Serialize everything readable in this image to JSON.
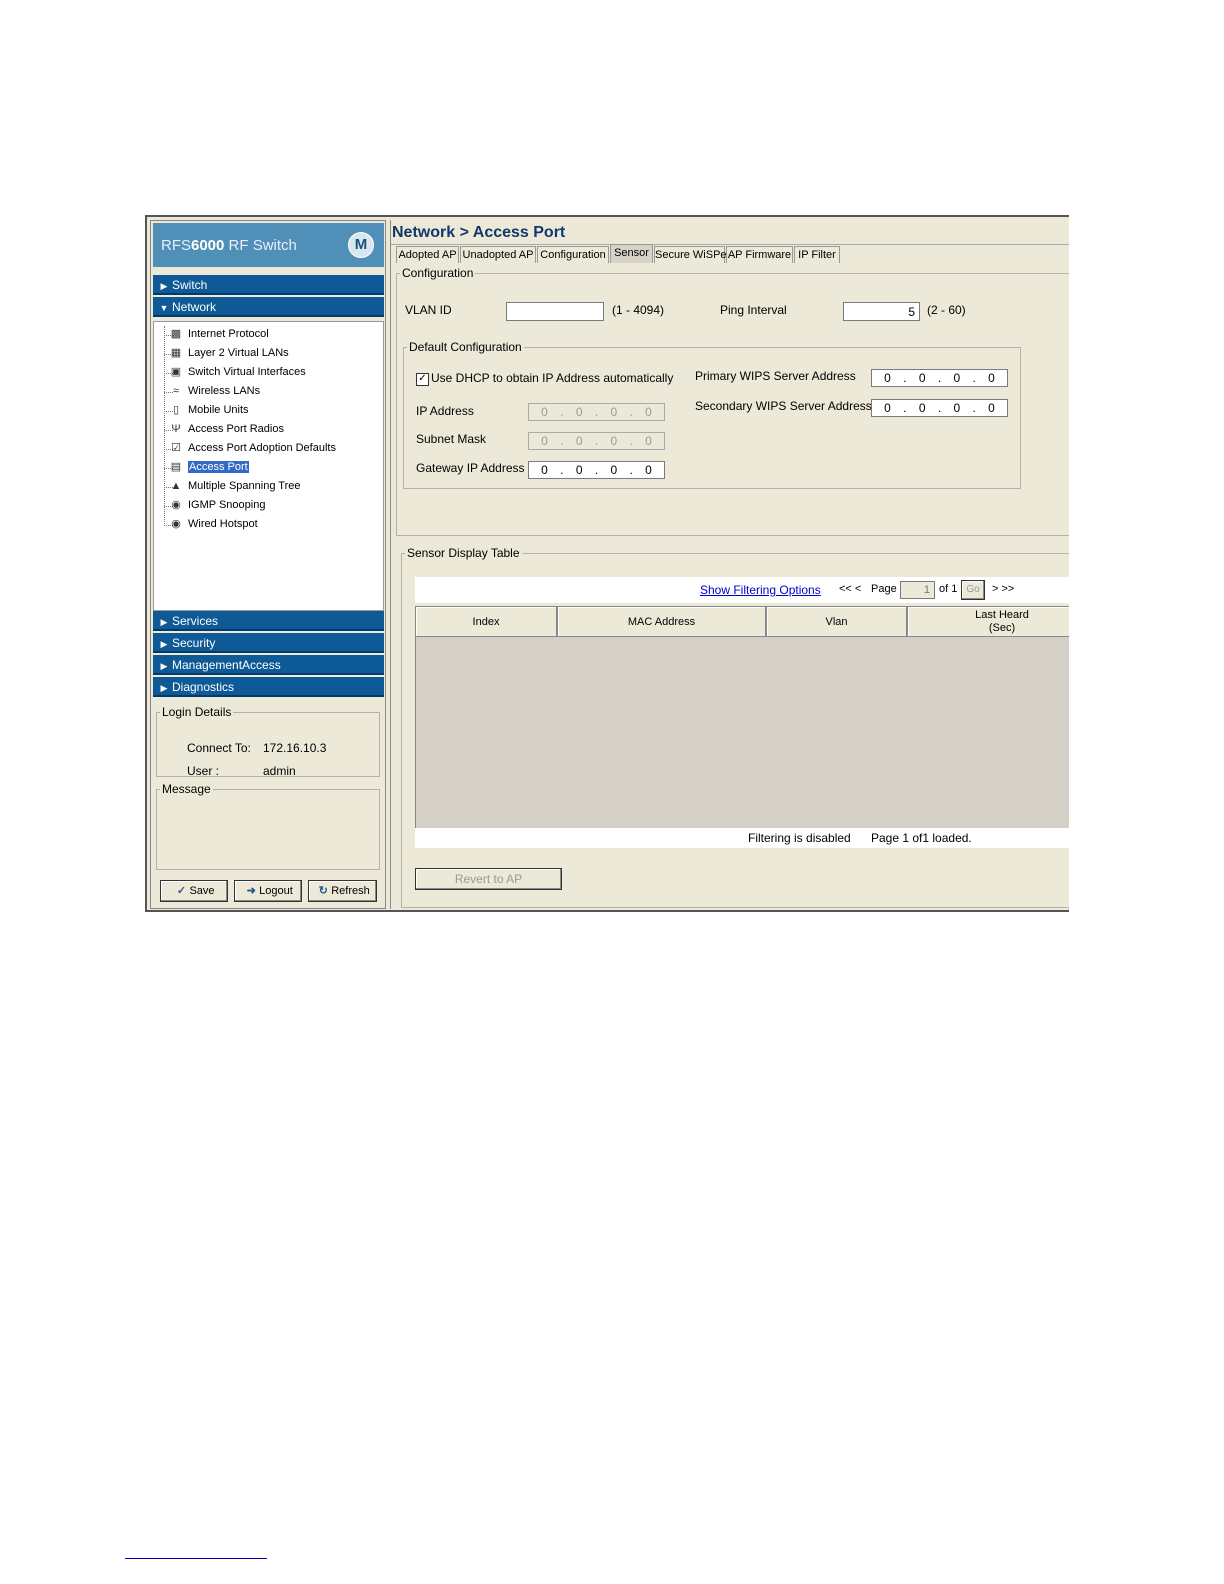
{
  "brand": {
    "title_prefix": "RFS",
    "title_bold": "6000",
    "title_suffix": " RF Switch",
    "logo": "motorola-logo"
  },
  "nav": {
    "switch": "Switch",
    "network": "Network",
    "services": "Services",
    "security": "Security",
    "management_access": "ManagementAccess",
    "diagnostics": "Diagnostics"
  },
  "tree": [
    {
      "label": "Internet Protocol",
      "icon": "ip-icon"
    },
    {
      "label": "Layer 2 Virtual LANs",
      "icon": "vlan-icon"
    },
    {
      "label": "Switch Virtual Interfaces",
      "icon": "svi-icon"
    },
    {
      "label": "Wireless LANs",
      "icon": "wlan-icon"
    },
    {
      "label": "Mobile Units",
      "icon": "mobile-unit-icon"
    },
    {
      "label": "Access Port Radios",
      "icon": "radio-icon"
    },
    {
      "label": "Access Port Adoption Defaults",
      "icon": "adoption-icon"
    },
    {
      "label": "Access Port",
      "icon": "access-port-icon"
    },
    {
      "label": "Multiple Spanning Tree",
      "icon": "spanning-tree-icon"
    },
    {
      "label": "IGMP Snooping",
      "icon": "igmp-icon"
    },
    {
      "label": "Wired Hotspot",
      "icon": "hotspot-icon"
    }
  ],
  "login": {
    "legend": "Login Details",
    "connect_label": "Connect To:",
    "connect_value": "172.16.10.3",
    "user_label": "User :",
    "user_value": "admin"
  },
  "message": {
    "legend": "Message"
  },
  "buttons": {
    "save": "Save",
    "logout": "Logout",
    "refresh": "Refresh"
  },
  "page": {
    "title": "Network > Access Port"
  },
  "tabs": [
    "Adopted AP",
    "Unadopted AP",
    "Configuration",
    "Sensor",
    "Secure WiSPe",
    "AP Firmware",
    "IP Filter"
  ],
  "active_tab": "Sensor",
  "config": {
    "legend": "Configuration",
    "vlan_label": "VLAN ID",
    "vlan_value": "",
    "vlan_range": "(1 - 4094)",
    "ping_label": "Ping Interval",
    "ping_value": "5",
    "ping_range": "(2 - 60)"
  },
  "default_config": {
    "legend": "Default Configuration",
    "dhcp_label": "Use DHCP to obtain IP Address automatically",
    "dhcp_checked": true,
    "ip_label": "IP Address",
    "subnet_label": "Subnet Mask",
    "gateway_label": "Gateway IP Address",
    "primary_label": "Primary WIPS Server Address",
    "secondary_label": "Secondary WIPS Server Address",
    "ip_value": [
      "0",
      "0",
      "0",
      "0"
    ],
    "subnet_value": [
      "0",
      "0",
      "0",
      "0"
    ],
    "gateway_value": [
      "0",
      "0",
      "0",
      "0"
    ],
    "primary_value": [
      "0",
      "0",
      "0",
      "0"
    ],
    "secondary_value": [
      "0",
      "0",
      "0",
      "0"
    ]
  },
  "sensor_table": {
    "legend": "Sensor Display Table",
    "filter_link": "Show Filtering Options",
    "pager_first_prev": "<< <",
    "pager_page_label": "Page",
    "pager_page_value": "1",
    "pager_of": "of 1",
    "pager_go": "Go",
    "pager_next_last": "> >>",
    "columns": [
      "Index",
      "MAC Address",
      "Vlan",
      "Last Heard\n(Sec)"
    ],
    "status_filter": "Filtering is disabled",
    "status_pages": "Page 1 of1 loaded.",
    "revert_button": "Revert to AP"
  }
}
